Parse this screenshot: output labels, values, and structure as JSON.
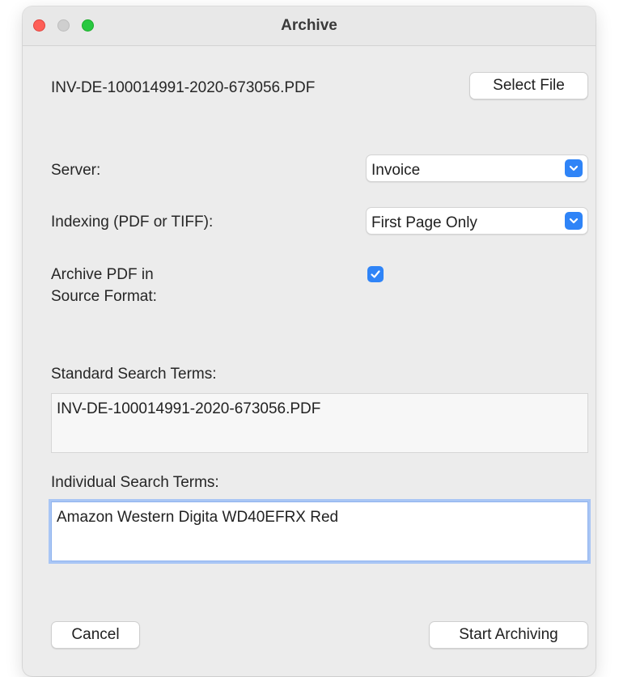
{
  "window": {
    "title": "Archive"
  },
  "file": {
    "name": "INV-DE-100014991-2020-673056.PDF",
    "select_label": "Select File"
  },
  "server": {
    "label": "Server:",
    "value": "Invoice"
  },
  "indexing": {
    "label": "Indexing (PDF or TIFF):",
    "value": "First Page Only"
  },
  "archive_pdf": {
    "label_line1": "Archive PDF in",
    "label_line2": "Source Format:",
    "checked": true
  },
  "standard_terms": {
    "label": "Standard Search Terms:",
    "value": "INV-DE-100014991-2020-673056.PDF"
  },
  "individual_terms": {
    "label": "Individual Search Terms:",
    "value": "Amazon Western Digita WD40EFRX Red"
  },
  "buttons": {
    "cancel": "Cancel",
    "start": "Start Archiving"
  },
  "colors": {
    "accent": "#2f84f7",
    "close": "#fe5f57",
    "maximize": "#28c840",
    "focus_ring": "#a9c6f5"
  }
}
